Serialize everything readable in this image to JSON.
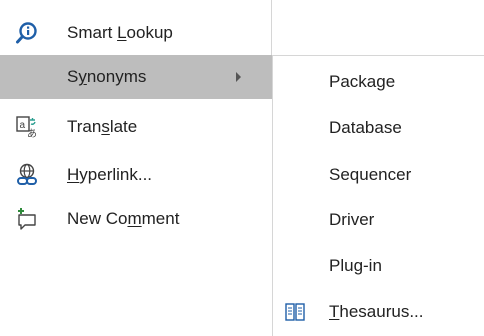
{
  "menu": {
    "items": [
      {
        "pre": "Smart ",
        "key": "L",
        "post": "ookup",
        "icon": "smart-lookup-icon",
        "selected": false
      },
      {
        "pre": "S",
        "key": "y",
        "post": "nonyms",
        "icon": "",
        "selected": true,
        "has_submenu": true
      },
      {
        "pre": "Tran",
        "key": "s",
        "post": "late",
        "icon": "translate-icon",
        "selected": false
      },
      {
        "pre": "",
        "key": "H",
        "post": "yperlink...",
        "icon": "hyperlink-icon",
        "selected": false
      },
      {
        "pre": "New Co",
        "key": "m",
        "post": "ment",
        "icon": "new-comment-icon",
        "selected": false
      }
    ]
  },
  "submenu": {
    "items": [
      {
        "label": "Package"
      },
      {
        "label": "Database"
      },
      {
        "label": "Sequencer"
      },
      {
        "label": "Driver"
      },
      {
        "label": "Plug-in"
      }
    ],
    "thesaurus": {
      "pre": "",
      "key": "T",
      "post": "hesaurus...",
      "icon": "thesaurus-icon"
    }
  },
  "colors": {
    "selected_bg": "#bdbdbd",
    "text": "#222222",
    "icon_blue": "#1f5fa8",
    "icon_teal": "#2a9d8f",
    "icon_green": "#2e8b3a"
  }
}
